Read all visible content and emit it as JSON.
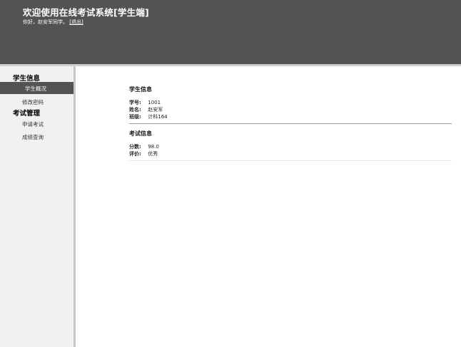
{
  "header": {
    "title": "欢迎使用在线考试系统[学生端]",
    "greeting": "你好，赵安军同学。",
    "logout_label": "[退出]"
  },
  "sidebar": {
    "groups": [
      {
        "title": "学生信息",
        "items": [
          {
            "label": "学生概况",
            "active": true
          },
          {
            "label": "修改密码",
            "active": false
          }
        ]
      },
      {
        "title": "考试管理",
        "items": [
          {
            "label": "申请考试",
            "active": false
          },
          {
            "label": "成绩查询",
            "active": false
          }
        ]
      }
    ]
  },
  "main": {
    "student_section": {
      "title": "学生信息",
      "rows": [
        {
          "label": "学号:",
          "value": "1001"
        },
        {
          "label": "姓名:",
          "value": "赵安军"
        },
        {
          "label": "班级:",
          "value": "计科164"
        }
      ]
    },
    "exam_section": {
      "title": "考试信息",
      "rows": [
        {
          "label": "分数:",
          "value": "98.0"
        },
        {
          "label": "评价:",
          "value": "优秀"
        }
      ]
    }
  },
  "colors": {
    "header_bg": "#535353",
    "sidebar_bg": "#f1f1f1",
    "active_item_bg": "#535353"
  }
}
